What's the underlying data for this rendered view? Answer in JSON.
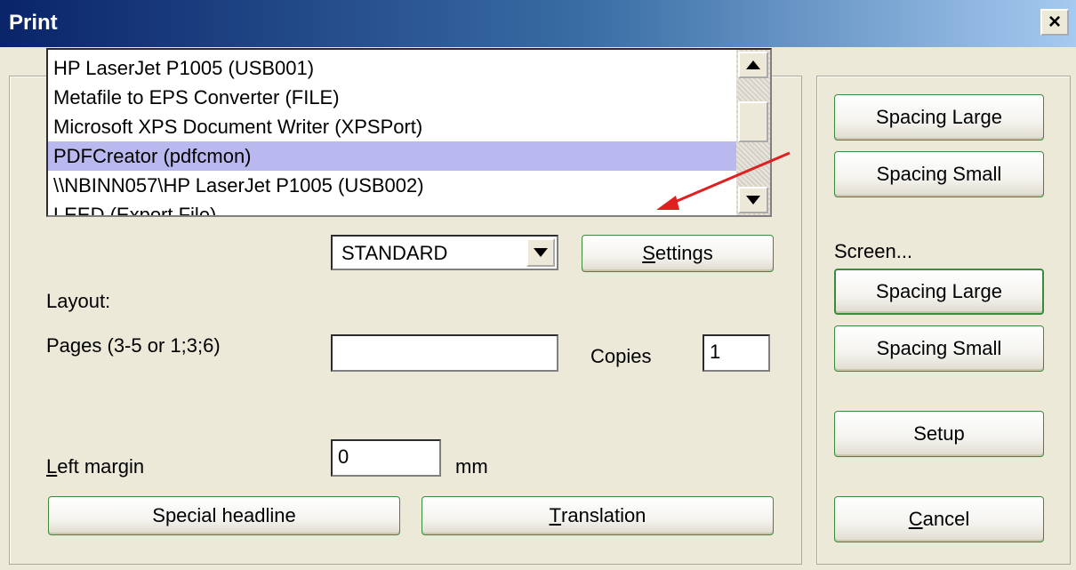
{
  "window": {
    "title": "Print",
    "close_label": "×"
  },
  "printers": {
    "items": [
      "HP LaserJet P1005 (USB001)",
      "Metafile to EPS Converter (FILE)",
      "Microsoft XPS Document Writer (XPSPort)",
      "PDFCreator (pdfcmon)",
      "\\\\NBINN057\\HP LaserJet P1005 (USB002)",
      "LEED (Export File)"
    ],
    "selected_index": 3,
    "selected_color": "#b9b9f0"
  },
  "layout": {
    "label": "Layout:",
    "value": "STANDARD"
  },
  "settings_button": {
    "underline_char": "S",
    "rest": "ettings"
  },
  "pages": {
    "label": "Pages (3-5 or 1;3;6)",
    "value": ""
  },
  "copies": {
    "label": "Copies",
    "value": "1"
  },
  "left_margin": {
    "underline_char": "L",
    "rest": "eft margin",
    "value": "0",
    "unit": "mm"
  },
  "special_headline_button": {
    "label": "Special headline"
  },
  "translation_button": {
    "underline_char": "T",
    "rest": "ranslation"
  },
  "right_panel": {
    "spacing_large_1": "Spacing Large",
    "spacing_small_1": "Spacing Small",
    "screen_label": "Screen...",
    "spacing_large_2": "Spacing Large",
    "spacing_small_2": "Spacing Small",
    "setup": "Setup",
    "cancel_underline_char": "C",
    "cancel_rest": "ancel"
  },
  "colors": {
    "titlebar_start": "#0a246a",
    "titlebar_end": "#a6caf0",
    "button_border": "#3c8a3c",
    "annotation_arrow": "#e02020"
  }
}
